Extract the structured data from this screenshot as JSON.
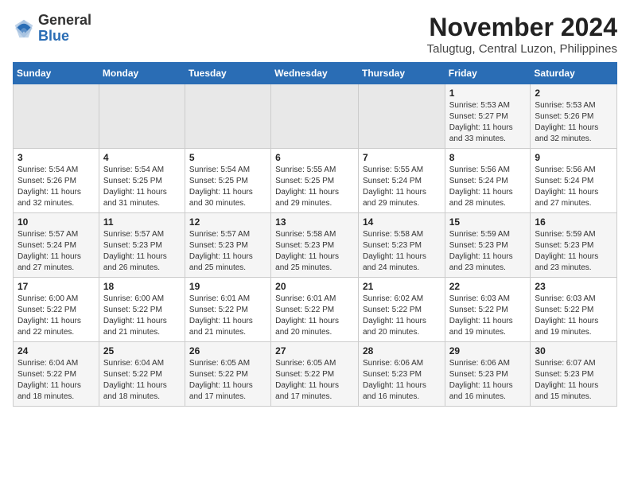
{
  "header": {
    "logo_general": "General",
    "logo_blue": "Blue",
    "title": "November 2024",
    "subtitle": "Talugtug, Central Luzon, Philippines"
  },
  "weekdays": [
    "Sunday",
    "Monday",
    "Tuesday",
    "Wednesday",
    "Thursday",
    "Friday",
    "Saturday"
  ],
  "weeks": [
    [
      {
        "day": "",
        "info": ""
      },
      {
        "day": "",
        "info": ""
      },
      {
        "day": "",
        "info": ""
      },
      {
        "day": "",
        "info": ""
      },
      {
        "day": "",
        "info": ""
      },
      {
        "day": "1",
        "info": "Sunrise: 5:53 AM\nSunset: 5:27 PM\nDaylight: 11 hours\nand 33 minutes."
      },
      {
        "day": "2",
        "info": "Sunrise: 5:53 AM\nSunset: 5:26 PM\nDaylight: 11 hours\nand 32 minutes."
      }
    ],
    [
      {
        "day": "3",
        "info": "Sunrise: 5:54 AM\nSunset: 5:26 PM\nDaylight: 11 hours\nand 32 minutes."
      },
      {
        "day": "4",
        "info": "Sunrise: 5:54 AM\nSunset: 5:25 PM\nDaylight: 11 hours\nand 31 minutes."
      },
      {
        "day": "5",
        "info": "Sunrise: 5:54 AM\nSunset: 5:25 PM\nDaylight: 11 hours\nand 30 minutes."
      },
      {
        "day": "6",
        "info": "Sunrise: 5:55 AM\nSunset: 5:25 PM\nDaylight: 11 hours\nand 29 minutes."
      },
      {
        "day": "7",
        "info": "Sunrise: 5:55 AM\nSunset: 5:24 PM\nDaylight: 11 hours\nand 29 minutes."
      },
      {
        "day": "8",
        "info": "Sunrise: 5:56 AM\nSunset: 5:24 PM\nDaylight: 11 hours\nand 28 minutes."
      },
      {
        "day": "9",
        "info": "Sunrise: 5:56 AM\nSunset: 5:24 PM\nDaylight: 11 hours\nand 27 minutes."
      }
    ],
    [
      {
        "day": "10",
        "info": "Sunrise: 5:57 AM\nSunset: 5:24 PM\nDaylight: 11 hours\nand 27 minutes."
      },
      {
        "day": "11",
        "info": "Sunrise: 5:57 AM\nSunset: 5:23 PM\nDaylight: 11 hours\nand 26 minutes."
      },
      {
        "day": "12",
        "info": "Sunrise: 5:57 AM\nSunset: 5:23 PM\nDaylight: 11 hours\nand 25 minutes."
      },
      {
        "day": "13",
        "info": "Sunrise: 5:58 AM\nSunset: 5:23 PM\nDaylight: 11 hours\nand 25 minutes."
      },
      {
        "day": "14",
        "info": "Sunrise: 5:58 AM\nSunset: 5:23 PM\nDaylight: 11 hours\nand 24 minutes."
      },
      {
        "day": "15",
        "info": "Sunrise: 5:59 AM\nSunset: 5:23 PM\nDaylight: 11 hours\nand 23 minutes."
      },
      {
        "day": "16",
        "info": "Sunrise: 5:59 AM\nSunset: 5:23 PM\nDaylight: 11 hours\nand 23 minutes."
      }
    ],
    [
      {
        "day": "17",
        "info": "Sunrise: 6:00 AM\nSunset: 5:22 PM\nDaylight: 11 hours\nand 22 minutes."
      },
      {
        "day": "18",
        "info": "Sunrise: 6:00 AM\nSunset: 5:22 PM\nDaylight: 11 hours\nand 21 minutes."
      },
      {
        "day": "19",
        "info": "Sunrise: 6:01 AM\nSunset: 5:22 PM\nDaylight: 11 hours\nand 21 minutes."
      },
      {
        "day": "20",
        "info": "Sunrise: 6:01 AM\nSunset: 5:22 PM\nDaylight: 11 hours\nand 20 minutes."
      },
      {
        "day": "21",
        "info": "Sunrise: 6:02 AM\nSunset: 5:22 PM\nDaylight: 11 hours\nand 20 minutes."
      },
      {
        "day": "22",
        "info": "Sunrise: 6:03 AM\nSunset: 5:22 PM\nDaylight: 11 hours\nand 19 minutes."
      },
      {
        "day": "23",
        "info": "Sunrise: 6:03 AM\nSunset: 5:22 PM\nDaylight: 11 hours\nand 19 minutes."
      }
    ],
    [
      {
        "day": "24",
        "info": "Sunrise: 6:04 AM\nSunset: 5:22 PM\nDaylight: 11 hours\nand 18 minutes."
      },
      {
        "day": "25",
        "info": "Sunrise: 6:04 AM\nSunset: 5:22 PM\nDaylight: 11 hours\nand 18 minutes."
      },
      {
        "day": "26",
        "info": "Sunrise: 6:05 AM\nSunset: 5:22 PM\nDaylight: 11 hours\nand 17 minutes."
      },
      {
        "day": "27",
        "info": "Sunrise: 6:05 AM\nSunset: 5:22 PM\nDaylight: 11 hours\nand 17 minutes."
      },
      {
        "day": "28",
        "info": "Sunrise: 6:06 AM\nSunset: 5:23 PM\nDaylight: 11 hours\nand 16 minutes."
      },
      {
        "day": "29",
        "info": "Sunrise: 6:06 AM\nSunset: 5:23 PM\nDaylight: 11 hours\nand 16 minutes."
      },
      {
        "day": "30",
        "info": "Sunrise: 6:07 AM\nSunset: 5:23 PM\nDaylight: 11 hours\nand 15 minutes."
      }
    ]
  ]
}
